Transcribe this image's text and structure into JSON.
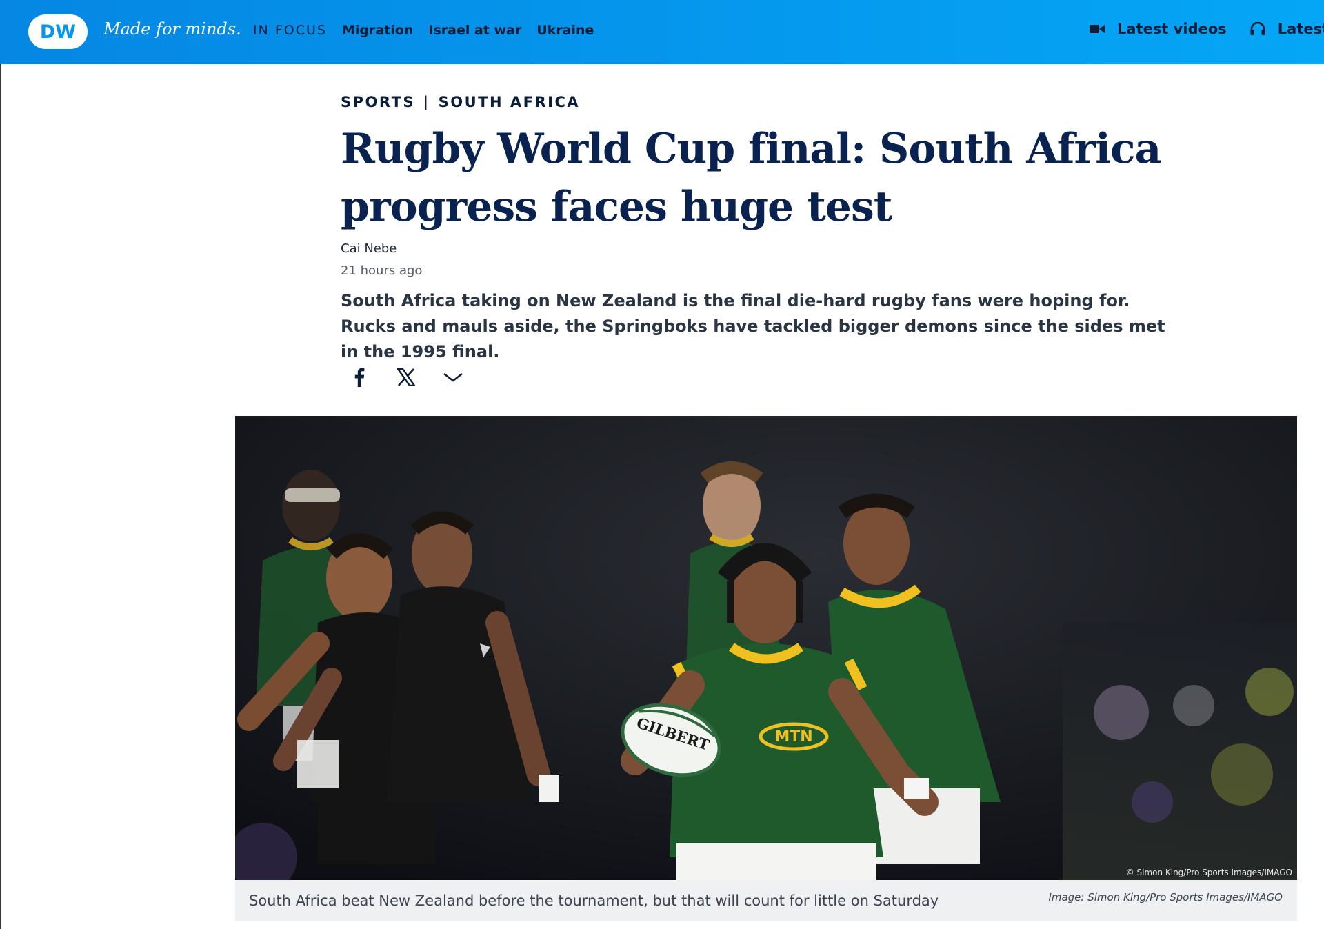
{
  "header": {
    "logo_text": "DW",
    "tagline": "Made for minds.",
    "focus_label": "IN FOCUS",
    "nav": [
      "Migration",
      "Israel at war",
      "Ukraine"
    ],
    "right_links": [
      {
        "label": "Latest videos",
        "icon": "video-camera-icon"
      },
      {
        "label": "Latest",
        "icon": "headphones-icon"
      }
    ]
  },
  "article": {
    "kicker": [
      "SPORTS",
      "SOUTH AFRICA"
    ],
    "kicker_separator": "|",
    "headline": "Rugby World Cup final: South Africa progress faces huge test",
    "author": "Cai Nebe",
    "published": "21 hours ago",
    "teaser": "South Africa taking on New Zealand is the final die-hard rugby fans were hoping for. Rucks and mauls aside, the Springboks have tackled bigger demons since the sides met in the 1995 final.",
    "share": [
      {
        "icon": "facebook-icon"
      },
      {
        "icon": "x-icon"
      },
      {
        "icon": "chevron-down-icon"
      }
    ]
  },
  "image": {
    "overlay_credit": "© Simon King/Pro Sports Images/IMAGO",
    "caption": "South Africa beat New Zealand before the tournament, but that will count for little on Saturday",
    "credit": "Image: Simon King/Pro Sports Images/IMAGO",
    "ball_text": "GILBERT",
    "jersey_text": "MTN"
  },
  "colors": {
    "header_start": "#0587e3",
    "header_end": "#05a6f6",
    "headline": "#0a2250",
    "springbok_green": "#1e5a2c",
    "springbok_gold": "#f0c020"
  }
}
